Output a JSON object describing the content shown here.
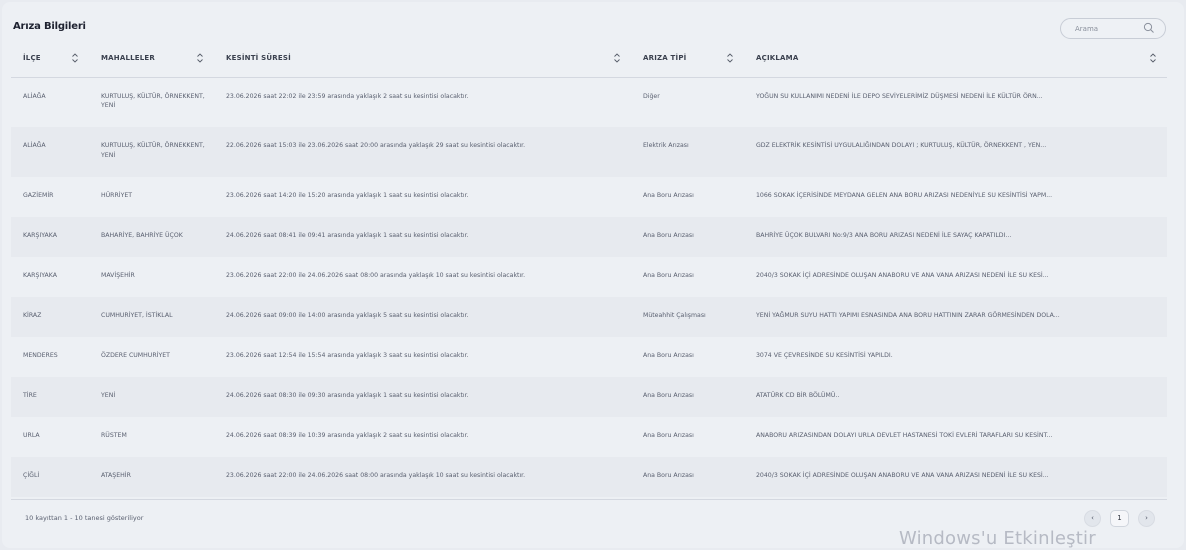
{
  "title": "Arıza Bilgileri",
  "search": {
    "placeholder": "Arama"
  },
  "columns": [
    "İLÇE",
    "MAHALLELER",
    "KESİNTİ SÜRESİ",
    "ARIZA TİPİ",
    "AÇIKLAMA"
  ],
  "rows": [
    {
      "ilce": "ALİAĞA",
      "mahalleler": "KURTULUŞ, KÜLTÜR, ÖRNEKKENT, YENİ",
      "sure": "23.06.2026 saat 22:02 ile 23:59 arasında yaklaşık 2 saat su kesintisi olacaktır.",
      "tip": "Diğer",
      "aciklama": "YOĞUN SU KULLANIMI NEDENİ İLE DEPO SEVİYELERİMİZ DÜŞMESİ NEDENİ İLE KÜLTÜR ÖRN..."
    },
    {
      "ilce": "ALİAĞA",
      "mahalleler": "KURTULUŞ, KÜLTÜR, ÖRNEKKENT, YENİ",
      "sure": "22.06.2026 saat 15:03 ile 23.06.2026 saat 20:00 arasında yaklaşık 29 saat su kesintisi olacaktır.",
      "tip": "Elektrik Arızası",
      "aciklama": "GDZ ELEKTRİK KESİNTİSİ UYGULALIĞINDAN DOLAYI ; KURTULUŞ, KÜLTÜR, ÖRNEKKENT , YEN..."
    },
    {
      "ilce": "GAZİEMİR",
      "mahalleler": "HÜRRİYET",
      "sure": "23.06.2026 saat 14:20 ile 15:20 arasında yaklaşık 1 saat su kesintisi olacaktır.",
      "tip": "Ana Boru Arızası",
      "aciklama": "1066 SOKAK İÇERİSİNDE MEYDANA GELEN ANA BORU ARIZASI NEDENİYLE SU KESİNTİSİ YAPM..."
    },
    {
      "ilce": "KARŞIYAKA",
      "mahalleler": "BAHARİYE, BAHRİYE ÜÇOK",
      "sure": "24.06.2026 saat 08:41 ile 09:41 arasında yaklaşık 1 saat su kesintisi olacaktır.",
      "tip": "Ana Boru Arızası",
      "aciklama": "BAHRİYE ÜÇOK BULVARI No:9/3 ANA BORU ARIZASI NEDENİ İLE SAYAÇ KAPATILDI..."
    },
    {
      "ilce": "KARŞIYAKA",
      "mahalleler": "MAVİŞEHİR",
      "sure": "23.06.2026 saat 22:00 ile 24.06.2026 saat 08:00 arasında yaklaşık 10 saat su kesintisi olacaktır.",
      "tip": "Ana Boru Arızası",
      "aciklama": "2040/3 SOKAK İÇİ ADRESİNDE OLUŞAN ANABORU VE ANA VANA ARIZASI NEDENİ İLE SU KESİ..."
    },
    {
      "ilce": "KİRAZ",
      "mahalleler": "CUMHURİYET, İSTİKLAL",
      "sure": "24.06.2026 saat 09:00 ile 14:00 arasında yaklaşık 5 saat su kesintisi olacaktır.",
      "tip": "Müteahhit Çalışması",
      "aciklama": "YENİ YAĞMUR SUYU HATTI YAPIMI ESNASINDA ANA BORU HATTININ ZARAR GÖRMESİNDEN DOLA..."
    },
    {
      "ilce": "MENDERES",
      "mahalleler": "ÖZDERE CUMHURİYET",
      "sure": "23.06.2026 saat 12:54 ile 15:54 arasında yaklaşık 3 saat su kesintisi olacaktır.",
      "tip": "Ana Boru Arızası",
      "aciklama": "3074 VE ÇEVRESİNDE SU KESİNTİSİ YAPILDI."
    },
    {
      "ilce": "TİRE",
      "mahalleler": "YENİ",
      "sure": "24.06.2026 saat 08:30 ile 09:30 arasında yaklaşık 1 saat su kesintisi olacaktır.",
      "tip": "Ana Boru Arızası",
      "aciklama": "ATATÜRK CD BİR BÖLÜMÜ.."
    },
    {
      "ilce": "URLA",
      "mahalleler": "RÜSTEM",
      "sure": "24.06.2026 saat 08:39 ile 10:39 arasında yaklaşık 2 saat su kesintisi olacaktır.",
      "tip": "Ana Boru Arızası",
      "aciklama": "ANABORU ARIZASINDAN DOLAYI URLA DEVLET HASTANESİ TOKİ EVLERİ TARAFLARI SU KESİNT..."
    },
    {
      "ilce": "ÇİĞLİ",
      "mahalleler": "ATAŞEHİR",
      "sure": "23.06.2026 saat 22:00 ile 24.06.2026 saat 08:00 arasında yaklaşık 10 saat su kesintisi olacaktır.",
      "tip": "Ana Boru Arızası",
      "aciklama": "2040/3 SOKAK İÇİ ADRESİNDE OLUŞAN ANABORU VE ANA VANA ARIZASI NEDENİ İLE SU KESİ..."
    }
  ],
  "footer": {
    "info": "10 kayıttan 1 - 10 tanesi gösteriliyor",
    "prev": "‹",
    "page": "1",
    "next": "›"
  },
  "watermark": "Windows'u Etkinleştir"
}
